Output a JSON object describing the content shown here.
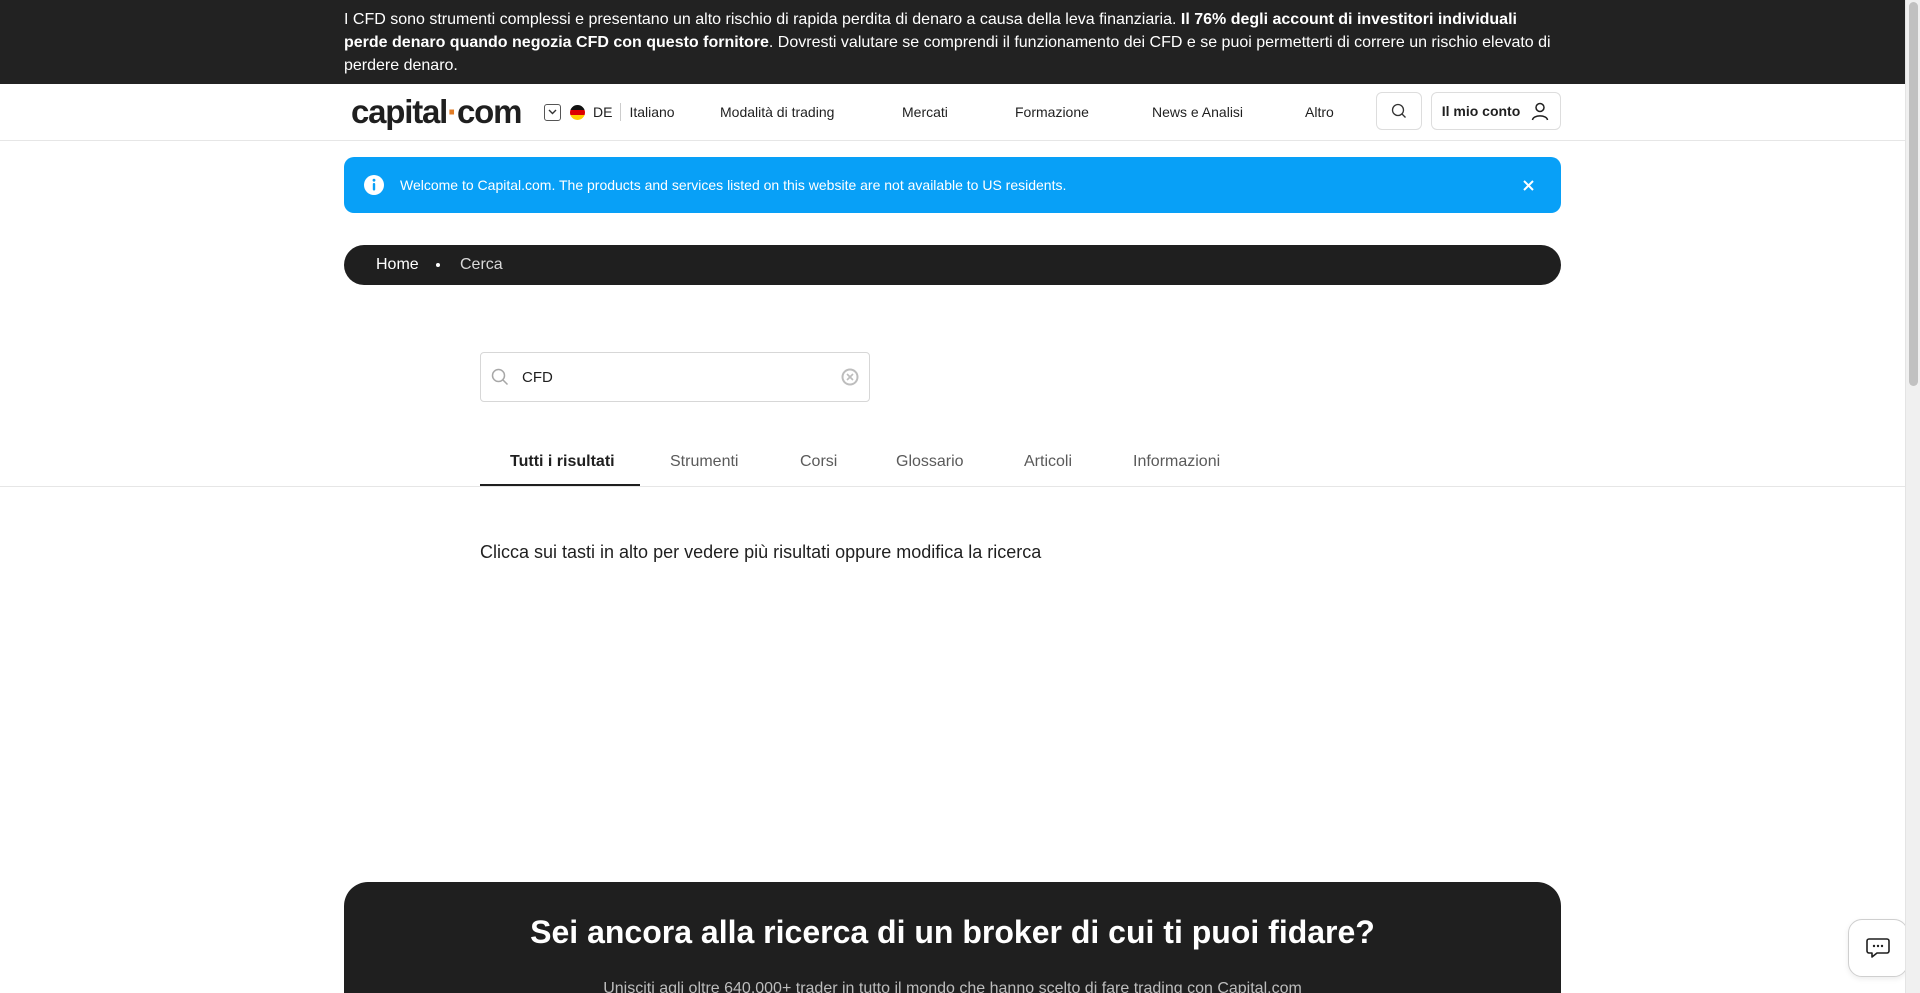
{
  "risk_banner": {
    "text_before": "I CFD sono strumenti complessi e presentano un alto rischio di rapida perdita di denaro a causa della leva finanziaria. ",
    "text_bold": "Il 76% degli account di investitori individuali perde denaro quando negozia CFD con questo fornitore",
    "text_after": ". Dovresti valutare se comprendi il funzionamento dei CFD e se puoi permetterti di correre un rischio elevato di perdere denaro."
  },
  "header": {
    "logo_left": "capital",
    "logo_dot": "·",
    "logo_right": "com",
    "region_code": "DE",
    "language": "Italiano",
    "nav": [
      "Modalità di trading",
      "Mercati",
      "Formazione",
      "News e Analisi",
      "Altro"
    ],
    "account_label": "Il mio conto"
  },
  "notice": {
    "text": "Welcome to Capital.com. The products and services listed on this website are not available to US residents."
  },
  "breadcrumb": {
    "home": "Home",
    "current": "Cerca"
  },
  "search": {
    "value": "CFD"
  },
  "tabs": [
    "Tutti i risultati",
    "Strumenti",
    "Corsi",
    "Glossario",
    "Articoli",
    "Informazioni"
  ],
  "active_tab": "Tutti i risultati",
  "hint": "Clicca sui tasti in alto per vedere più risultati oppure modifica la ricerca",
  "cta": {
    "title": "Sei ancora alla ricerca di un broker di cui ti puoi fidare?",
    "subtitle": "Unisciti agli oltre 640.000+ trader in tutto il mondo che hanno scelto di fare trading con Capital.com"
  },
  "colors": {
    "banner_bg": "#222222",
    "notice_bg": "#08a0f7",
    "dark": "#1f1f1f",
    "logo_accent": "#e07b25"
  },
  "icons": [
    "chevron-down-icon",
    "germany-flag-icon",
    "search-icon",
    "user-icon",
    "info-icon",
    "close-icon",
    "clear-icon",
    "chat-icon"
  ]
}
